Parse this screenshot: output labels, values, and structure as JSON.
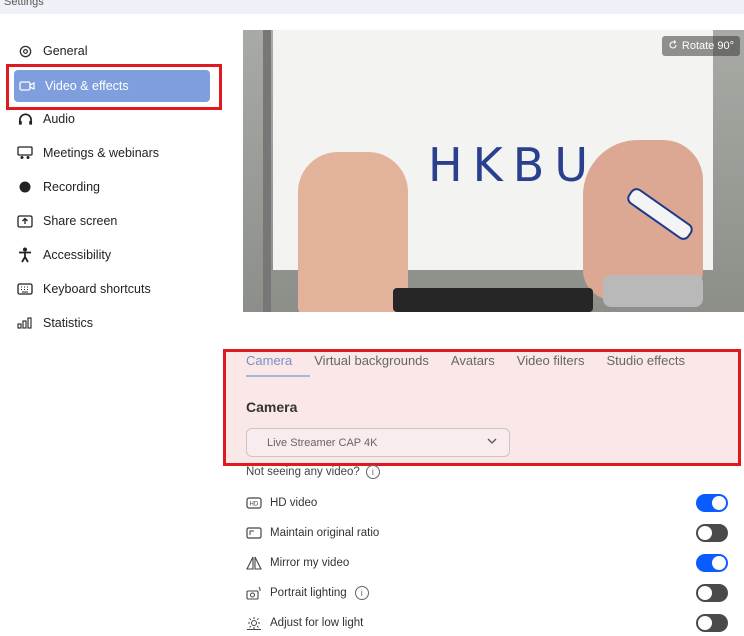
{
  "window": {
    "title": "Settings"
  },
  "sidebar": {
    "items": [
      {
        "label": "General",
        "icon": "gear-icon"
      },
      {
        "label": "Video & effects",
        "icon": "video-camera-icon",
        "active": true
      },
      {
        "label": "Audio",
        "icon": "headphones-icon"
      },
      {
        "label": "Meetings & webinars",
        "icon": "meetings-icon"
      },
      {
        "label": "Recording",
        "icon": "record-icon"
      },
      {
        "label": "Share screen",
        "icon": "share-screen-icon"
      },
      {
        "label": "Accessibility",
        "icon": "accessibility-icon"
      },
      {
        "label": "Keyboard shortcuts",
        "icon": "keyboard-icon"
      },
      {
        "label": "Statistics",
        "icon": "statistics-icon"
      }
    ]
  },
  "preview": {
    "rotate_label": "Rotate 90°",
    "board_text": "HKBU"
  },
  "tabs": {
    "items": [
      "Camera",
      "Virtual backgrounds",
      "Avatars",
      "Video filters",
      "Studio effects"
    ],
    "active": "Camera"
  },
  "camera": {
    "section_title": "Camera",
    "selected_device": "Live Streamer CAP 4K",
    "help_text": "Not seeing any video?"
  },
  "options": [
    {
      "label": "HD video",
      "icon": "hd-icon",
      "on": true
    },
    {
      "label": "Maintain original ratio",
      "icon": "ratio-icon",
      "on": false
    },
    {
      "label": "Mirror my video",
      "icon": "mirror-icon",
      "on": true
    },
    {
      "label": "Portrait lighting",
      "icon": "portrait-lighting-icon",
      "on": false,
      "has_info": true
    },
    {
      "label": "Adjust for low light",
      "icon": "low-light-icon",
      "on": false
    }
  ],
  "colors": {
    "accent": "#0b5cff",
    "active_item": "#7f9ede",
    "highlight_border": "#e0191f"
  }
}
